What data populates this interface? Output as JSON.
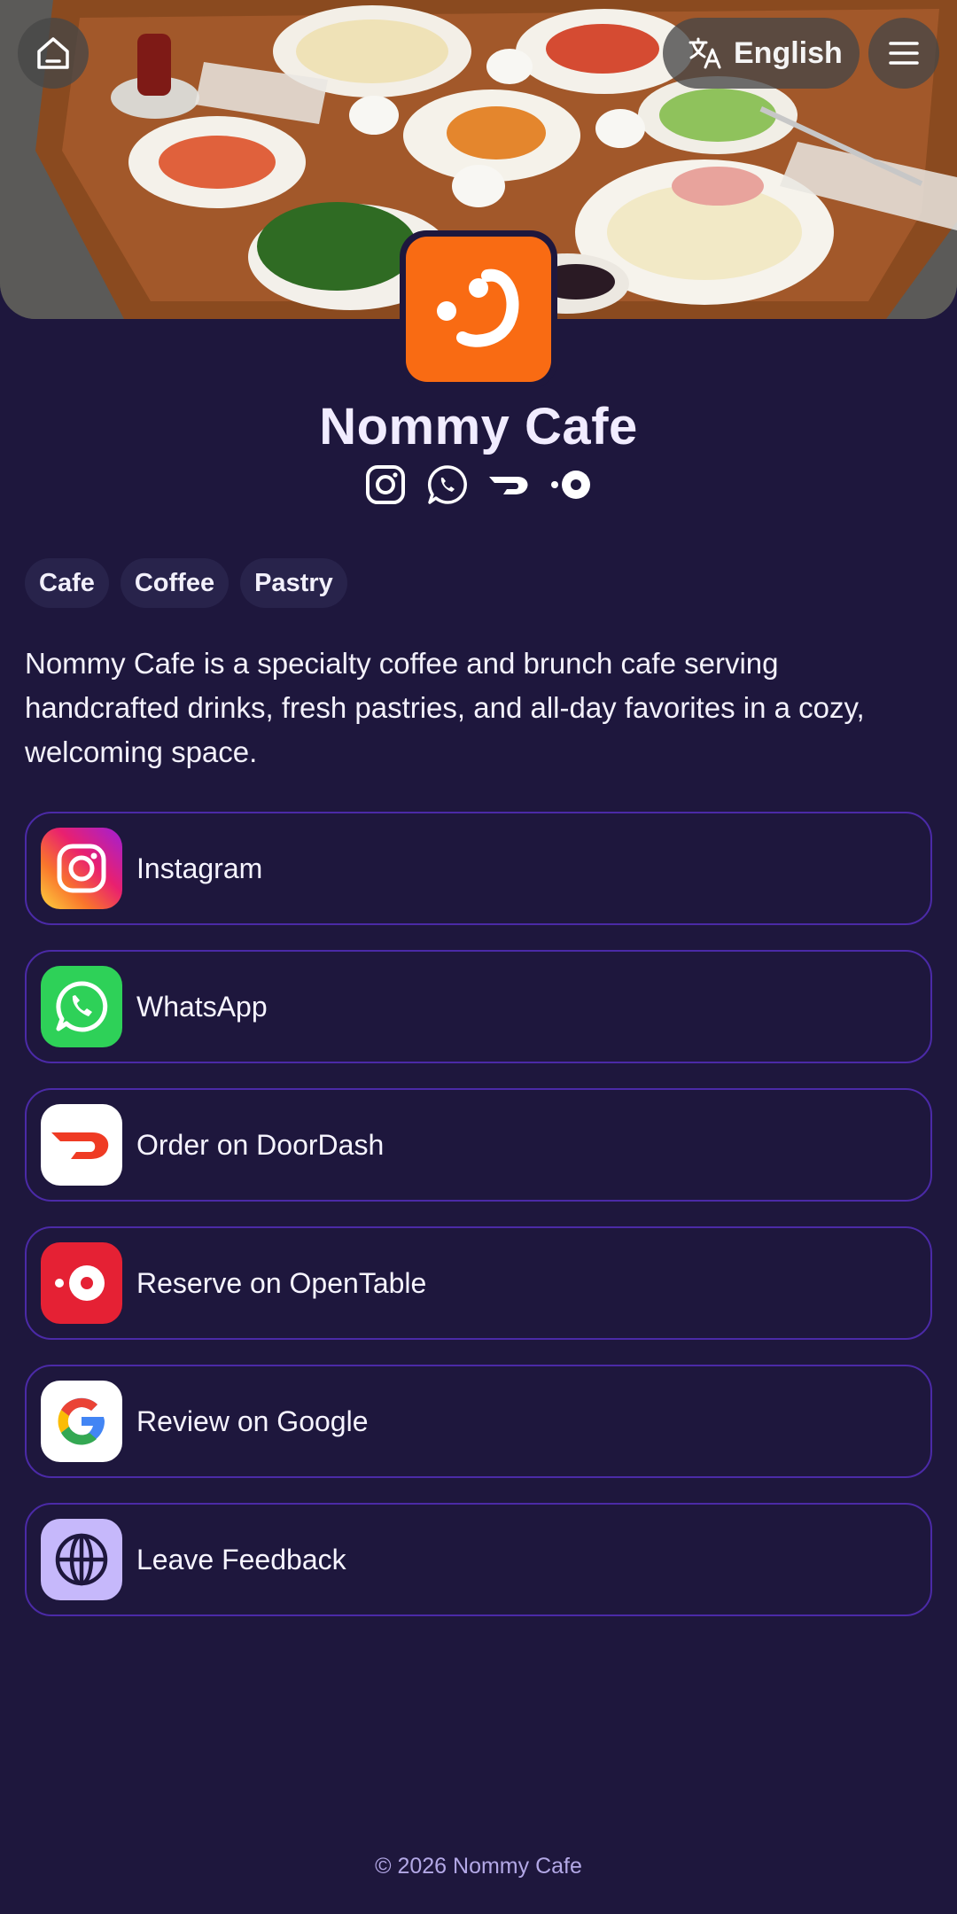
{
  "header": {
    "language_label": "English",
    "home_icon": "home-icon",
    "translate_icon": "translate-icon",
    "menu_icon": "menu-icon"
  },
  "profile": {
    "name": "Nommy Cafe",
    "logo_color": "#f96b13",
    "social_icons": [
      "instagram-icon",
      "whatsapp-icon",
      "doordash-icon",
      "opentable-icon"
    ]
  },
  "tags": [
    "Cafe",
    "Coffee",
    "Pastry"
  ],
  "description": "Nommy Cafe is a specialty coffee and brunch cafe serving handcrafted drinks, fresh pastries, and all-day favorites in a cozy, welcoming space.",
  "links": [
    {
      "label": "Instagram",
      "icon": "instagram-icon"
    },
    {
      "label": "WhatsApp",
      "icon": "whatsapp-icon",
      "color": "#2ed158"
    },
    {
      "label": "Order on DoorDash",
      "icon": "doordash-icon",
      "color": "#ef3b24"
    },
    {
      "label": "Reserve on OpenTable",
      "icon": "opentable-icon",
      "color": "#e52134"
    },
    {
      "label": "Review on Google",
      "icon": "google-icon"
    },
    {
      "label": "Leave Feedback",
      "icon": "globe-icon",
      "color": "#c6b8fb"
    }
  ],
  "footer": {
    "copyright": "© 2026 Nommy Cafe"
  },
  "colors": {
    "background": "#1e173d",
    "card_border": "#4b2aa7",
    "tag_bg": "#28234b"
  }
}
